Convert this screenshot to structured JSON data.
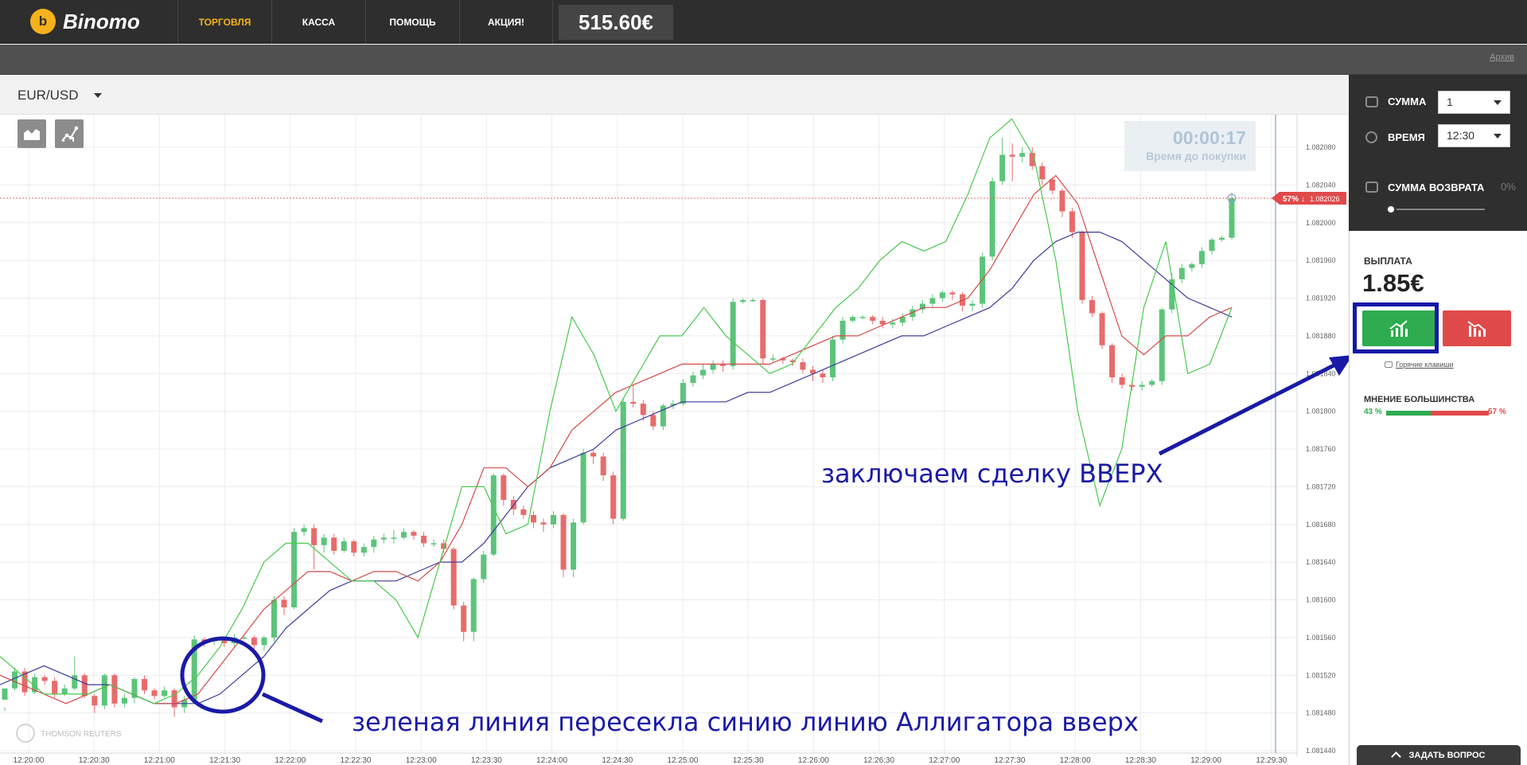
{
  "header": {
    "brand": "Binomo",
    "brand_mark": "b-coin-logo",
    "nav": [
      "ТОРГОВЛЯ",
      "КАССА",
      "ПОМОЩЬ",
      "АКЦИЯ!"
    ],
    "active_nav": "ТОРГОВЛЯ",
    "balance": "515.60€"
  },
  "subheader": {
    "archive_link": "Архив"
  },
  "asset": {
    "pair": "EUR/USD"
  },
  "toolbar": {
    "icons": [
      "area-chart-icon",
      "indicators-icon"
    ]
  },
  "timer": {
    "value": "00:00:17",
    "label": "Время до покупки"
  },
  "panel": {
    "amount_label": "СУММА",
    "amount_value": "1",
    "time_label": "ВРЕМЯ",
    "time_value": "12:30",
    "return_label": "СУММА ВОЗВРАТА",
    "return_value": "0%",
    "return_slider_fraction": 0.0,
    "payout_label": "ВЫПЛАТА",
    "payout_value": "1.85€",
    "hotkeys_label": "Горячие клавиши",
    "majority_label": "МНЕНИЕ БОЛЬШИНСТВА",
    "majority_up": "43 %",
    "majority_down": "57 %",
    "majority_up_fraction": 0.43,
    "ask_button": "ЗАДАТЬ ВОПРОС"
  },
  "colors": {
    "accent": "#f6b21b",
    "up": "#2eac4f",
    "down": "#e04a4a",
    "candle_up": "#5cc47a",
    "candle_down": "#e86b6b",
    "lips": "#47c94d",
    "teeth": "#d44a4a",
    "jaw": "#3c3c9a",
    "annotation": "#1a1aa6"
  },
  "annotations": {
    "up_trade": "заключаем сделку ВВЕРХ",
    "crossing": "зеленая линия пересекла синию линию Аллигатора вверх"
  },
  "chart_data": {
    "type": "candlestick",
    "price_ticks": [
      "1.082080",
      "1.082040",
      "1.082000",
      "1.081960",
      "1.081920",
      "1.081880",
      "1.081840",
      "1.081800",
      "1.081760",
      "1.081720",
      "1.081680",
      "1.081640",
      "1.081600",
      "1.081560",
      "1.081520",
      "1.081480",
      "1.081440"
    ],
    "price_values": [
      1.08208,
      1.08204,
      1.082,
      1.08196,
      1.08192,
      1.08188,
      1.08184,
      1.0818,
      1.08176,
      1.08172,
      1.08168,
      1.08164,
      1.0816,
      1.08156,
      1.08152,
      1.08148,
      1.08144
    ],
    "time_ticks": [
      "12:20:00",
      "12:20:30",
      "12:21:00",
      "12:21:30",
      "12:22:00",
      "12:22:30",
      "12:23:00",
      "12:23:30",
      "12:24:00",
      "12:24:30",
      "12:25:00",
      "12:25:30",
      "12:26:00",
      "12:26:30",
      "12:27:00",
      "12:27:30",
      "12:28:00",
      "12:28:30",
      "12:29:00",
      "12:29:30"
    ],
    "current_price": "1.082026",
    "current_pct": "57%",
    "candles": [
      [
        1.081494,
        1.081506,
        1.081486,
        1.081482
      ],
      [
        1.081506,
        1.081524,
        1.081528,
        1.081504
      ],
      [
        1.081524,
        1.081502,
        1.081528,
        1.081498
      ],
      [
        1.081502,
        1.081518,
        1.081522,
        1.0815
      ],
      [
        1.081518,
        1.081514,
        1.08152,
        1.08151
      ],
      [
        1.081514,
        1.0815,
        1.081518,
        1.081496
      ],
      [
        1.0815,
        1.081506,
        1.08151,
        1.081498
      ],
      [
        1.081506,
        1.08152,
        1.08154,
        1.081504
      ],
      [
        1.08152,
        1.081498,
        1.081522,
        1.081496
      ],
      [
        1.081498,
        1.081488,
        1.0815,
        1.08148
      ],
      [
        1.081488,
        1.08152,
        1.081522,
        1.081484
      ],
      [
        1.08152,
        1.08149,
        1.081522,
        1.081486
      ],
      [
        1.08149,
        1.081496,
        1.0815,
        1.081486
      ],
      [
        1.081496,
        1.081516,
        1.081518,
        1.08149
      ],
      [
        1.081516,
        1.081504,
        1.08152,
        1.0815
      ],
      [
        1.081504,
        1.081498,
        1.081506,
        1.081494
      ],
      [
        1.081498,
        1.081504,
        1.081508,
        1.081496
      ],
      [
        1.081504,
        1.081486,
        1.081506,
        1.081476
      ],
      [
        1.081486,
        1.081494,
        1.081498,
        1.08148
      ],
      [
        1.081494,
        1.081558,
        1.081562,
        1.081492
      ],
      [
        1.081558,
        1.081556,
        1.08156,
        1.08155
      ],
      [
        1.081556,
        1.081558,
        1.08156,
        1.081552
      ],
      [
        1.081558,
        1.081554,
        1.08156,
        1.08155
      ],
      [
        1.081554,
        1.08156,
        1.081564,
        1.08155
      ],
      [
        1.08156,
        1.08156,
        1.081562,
        1.081558
      ],
      [
        1.08156,
        1.081552,
        1.081562,
        1.081544
      ],
      [
        1.081552,
        1.08156,
        1.081562,
        1.081546
      ],
      [
        1.08156,
        1.0816,
        1.081604,
        1.081556
      ],
      [
        1.0816,
        1.081592,
        1.081604,
        1.081584
      ],
      [
        1.081592,
        1.081672,
        1.081676,
        1.08159
      ],
      [
        1.081672,
        1.081676,
        1.08168,
        1.081668
      ],
      [
        1.081676,
        1.081658,
        1.08168,
        1.081632
      ],
      [
        1.081658,
        1.081666,
        1.08167,
        1.08165
      ],
      [
        1.081666,
        1.081652,
        1.08167,
        1.081648
      ],
      [
        1.081652,
        1.081662,
        1.081666,
        1.08165
      ],
      [
        1.081662,
        1.08165,
        1.081664,
        1.081646
      ],
      [
        1.08165,
        1.081656,
        1.08166,
        1.081646
      ],
      [
        1.081656,
        1.081664,
        1.081668,
        1.08165
      ],
      [
        1.081664,
        1.081666,
        1.08167,
        1.08166
      ],
      [
        1.081666,
        1.081666,
        1.081674,
        1.08166
      ],
      [
        1.081666,
        1.081672,
        1.081676,
        1.081664
      ],
      [
        1.081672,
        1.081668,
        1.081674,
        1.081664
      ],
      [
        1.081668,
        1.08166,
        1.081672,
        1.081656
      ],
      [
        1.08166,
        1.08166,
        1.081664,
        1.081656
      ],
      [
        1.08166,
        1.081654,
        1.081664,
        1.08165
      ],
      [
        1.081654,
        1.081594,
        1.081656,
        1.08159
      ],
      [
        1.081594,
        1.081566,
        1.081598,
        1.081556
      ],
      [
        1.081566,
        1.081622,
        1.081624,
        1.081556
      ],
      [
        1.081622,
        1.081648,
        1.081652,
        1.081618
      ],
      [
        1.081648,
        1.081732,
        1.081734,
        1.081646
      ],
      [
        1.081732,
        1.081706,
        1.081734,
        1.0817
      ],
      [
        1.081706,
        1.081696,
        1.08171,
        1.08169
      ],
      [
        1.081696,
        1.08169,
        1.0817,
        1.081686
      ],
      [
        1.08169,
        1.081682,
        1.081694,
        1.081676
      ],
      [
        1.081682,
        1.08168,
        1.081686,
        1.081672
      ],
      [
        1.08168,
        1.08169,
        1.081694,
        1.081676
      ],
      [
        1.08169,
        1.081632,
        1.081692,
        1.081624
      ],
      [
        1.081632,
        1.081682,
        1.081686,
        1.081624
      ],
      [
        1.081682,
        1.081756,
        1.08176,
        1.08168
      ],
      [
        1.081756,
        1.081752,
        1.08176,
        1.081744
      ],
      [
        1.081752,
        1.081732,
        1.081756,
        1.081726
      ],
      [
        1.081732,
        1.081686,
        1.081736,
        1.08168
      ],
      [
        1.081686,
        1.08181,
        1.081814,
        1.081684
      ],
      [
        1.08181,
        1.081808,
        1.081828,
        1.081804
      ],
      [
        1.081808,
        1.081796,
        1.081812,
        1.08179
      ],
      [
        1.081796,
        1.081784,
        1.0818,
        1.08178
      ],
      [
        1.081784,
        1.081806,
        1.081808,
        1.08178
      ],
      [
        1.081806,
        1.081808,
        1.081812,
        1.081802
      ],
      [
        1.081808,
        1.08183,
        1.081834,
        1.081806
      ],
      [
        1.08183,
        1.081838,
        1.081842,
        1.081826
      ],
      [
        1.081838,
        1.081844,
        1.08185,
        1.081834
      ],
      [
        1.081844,
        1.08185,
        1.081854,
        1.08184
      ],
      [
        1.08185,
        1.081848,
        1.081854,
        1.081842
      ],
      [
        1.081848,
        1.081916,
        1.08192,
        1.081844
      ],
      [
        1.081916,
        1.081918,
        1.08192,
        1.081914
      ],
      [
        1.081918,
        1.081918,
        1.08192,
        1.081916
      ],
      [
        1.081918,
        1.081856,
        1.08192,
        1.08185
      ],
      [
        1.081856,
        1.081856,
        1.08186,
        1.081852
      ],
      [
        1.081856,
        1.081854,
        1.081858,
        1.08185
      ],
      [
        1.081854,
        1.081852,
        1.081856,
        1.081848
      ],
      [
        1.081852,
        1.081844,
        1.081856,
        1.08184
      ],
      [
        1.081844,
        1.08184,
        1.081848,
        1.081832
      ],
      [
        1.08184,
        1.081836,
        1.081844,
        1.08183
      ],
      [
        1.081836,
        1.081876,
        1.08188,
        1.081832
      ],
      [
        1.081876,
        1.081896,
        1.0819,
        1.081872
      ],
      [
        1.081896,
        1.0819,
        1.081902,
        1.081894
      ],
      [
        1.0819,
        1.0819,
        1.081902,
        1.081898
      ],
      [
        1.0819,
        1.081896,
        1.081902,
        1.081892
      ],
      [
        1.081896,
        1.081892,
        1.0819,
        1.081888
      ],
      [
        1.081892,
        1.081894,
        1.081898,
        1.081888
      ],
      [
        1.081894,
        1.0819,
        1.081904,
        1.08189
      ],
      [
        1.0819,
        1.081908,
        1.081912,
        1.081896
      ],
      [
        1.081908,
        1.081914,
        1.081918,
        1.081904
      ],
      [
        1.081914,
        1.08192,
        1.081924,
        1.08191
      ],
      [
        1.08192,
        1.081926,
        1.081928,
        1.081916
      ],
      [
        1.081926,
        1.081924,
        1.081928,
        1.081918
      ],
      [
        1.081924,
        1.081912,
        1.081926,
        1.081906
      ],
      [
        1.081912,
        1.081914,
        1.081918,
        1.081906
      ],
      [
        1.081914,
        1.081964,
        1.081968,
        1.08191
      ],
      [
        1.081964,
        1.082044,
        1.082048,
        1.08196
      ],
      [
        1.082044,
        1.082072,
        1.08209,
        1.08204
      ],
      [
        1.082072,
        1.08207,
        1.082084,
        1.082044
      ],
      [
        1.08207,
        1.082074,
        1.08208,
        1.082064
      ],
      [
        1.082074,
        1.08206,
        1.08208,
        1.082056
      ],
      [
        1.08206,
        1.082046,
        1.082064,
        1.08204
      ],
      [
        1.082046,
        1.082034,
        1.082048,
        1.08203
      ],
      [
        1.082034,
        1.082012,
        1.082036,
        1.082006
      ],
      [
        1.082012,
        1.08199,
        1.082016,
        1.081984
      ],
      [
        1.08199,
        1.081918,
        1.081992,
        1.081914
      ],
      [
        1.081918,
        1.081904,
        1.081922,
        1.0819
      ],
      [
        1.081904,
        1.08187,
        1.081906,
        1.081866
      ],
      [
        1.08187,
        1.081836,
        1.081872,
        1.08183
      ],
      [
        1.081836,
        1.081828,
        1.08184,
        1.081824
      ],
      [
        1.081828,
        1.081826,
        1.081832,
        1.081822
      ],
      [
        1.081826,
        1.081828,
        1.081832,
        1.081822
      ],
      [
        1.081828,
        1.081832,
        1.081834,
        1.081826
      ],
      [
        1.081832,
        1.081908,
        1.08191,
        1.081828
      ],
      [
        1.081908,
        1.08194,
        1.081946,
        1.081904
      ],
      [
        1.08194,
        1.081952,
        1.081956,
        1.081936
      ],
      [
        1.081952,
        1.081956,
        1.081958,
        1.081948
      ],
      [
        1.081956,
        1.08197,
        1.081974,
        1.081952
      ],
      [
        1.08197,
        1.081982,
        1.081984,
        1.081966
      ],
      [
        1.081982,
        1.081984,
        1.081986,
        1.08198
      ],
      [
        1.081984,
        1.082026,
        1.082032,
        1.081982
      ]
    ],
    "alligator": {
      "lips": [
        [
          1.08154,
          1.08152,
          1.0815,
          1.0815,
          1.0815,
          1.08151,
          1.0815,
          1.08149,
          1.0815,
          1.08152,
          1.08155,
          1.08159,
          1.08164,
          1.08166,
          1.08166,
          1.08164,
          1.08162,
          1.08162,
          1.0816,
          1.08156,
          1.08164,
          1.08172,
          1.08172,
          1.08167,
          1.08168,
          1.0818,
          1.0819,
          1.08186,
          1.0818,
          1.08184,
          1.08188,
          1.08188,
          1.08191,
          1.08188,
          1.08186,
          1.08184,
          1.08185,
          1.08188,
          1.08191,
          1.08193,
          1.08196,
          1.08198,
          1.08197,
          1.08198,
          1.08203,
          1.08209,
          1.08211,
          1.08207,
          1.08196,
          1.0818,
          1.0817,
          1.08176,
          1.08191,
          1.08198,
          1.08184,
          1.08185,
          1.08191
        ]
      ],
      "teeth": [
        [
          1.08152,
          1.08151,
          1.0815,
          1.08149,
          1.0815,
          1.08151,
          1.0815,
          1.08149,
          1.08149,
          1.0815,
          1.08153,
          1.08156,
          1.08159,
          1.08161,
          1.08163,
          1.08163,
          1.08162,
          1.08163,
          1.08163,
          1.08162,
          1.08164,
          1.08168,
          1.08174,
          1.08174,
          1.08172,
          1.08174,
          1.08178,
          1.0818,
          1.08182,
          1.08183,
          1.08184,
          1.08185,
          1.08185,
          1.08185,
          1.08185,
          1.08185,
          1.08186,
          1.08187,
          1.08188,
          1.08188,
          1.08189,
          1.0819,
          1.08191,
          1.08191,
          1.08192,
          1.08195,
          1.08199,
          1.08203,
          1.08205,
          1.08202,
          1.08195,
          1.08188,
          1.08186,
          1.08188,
          1.08188,
          1.0819,
          1.08191
        ]
      ],
      "jaw": [
        [
          1.08151,
          1.08152,
          1.08153,
          1.08152,
          1.08151,
          1.08151,
          1.0815,
          1.08149,
          1.08149,
          1.08149,
          1.0815,
          1.08152,
          1.08154,
          1.08157,
          1.08159,
          1.08161,
          1.08162,
          1.08162,
          1.08162,
          1.08163,
          1.08164,
          1.08164,
          1.08166,
          1.08169,
          1.08172,
          1.08174,
          1.08175,
          1.08176,
          1.08178,
          1.08179,
          1.0818,
          1.08181,
          1.08181,
          1.08181,
          1.08182,
          1.08182,
          1.08183,
          1.08184,
          1.08185,
          1.08186,
          1.08187,
          1.08188,
          1.08188,
          1.08189,
          1.0819,
          1.08191,
          1.08193,
          1.08196,
          1.08198,
          1.08199,
          1.08199,
          1.08198,
          1.08196,
          1.08194,
          1.08192,
          1.08191,
          1.0819
        ]
      ]
    }
  }
}
